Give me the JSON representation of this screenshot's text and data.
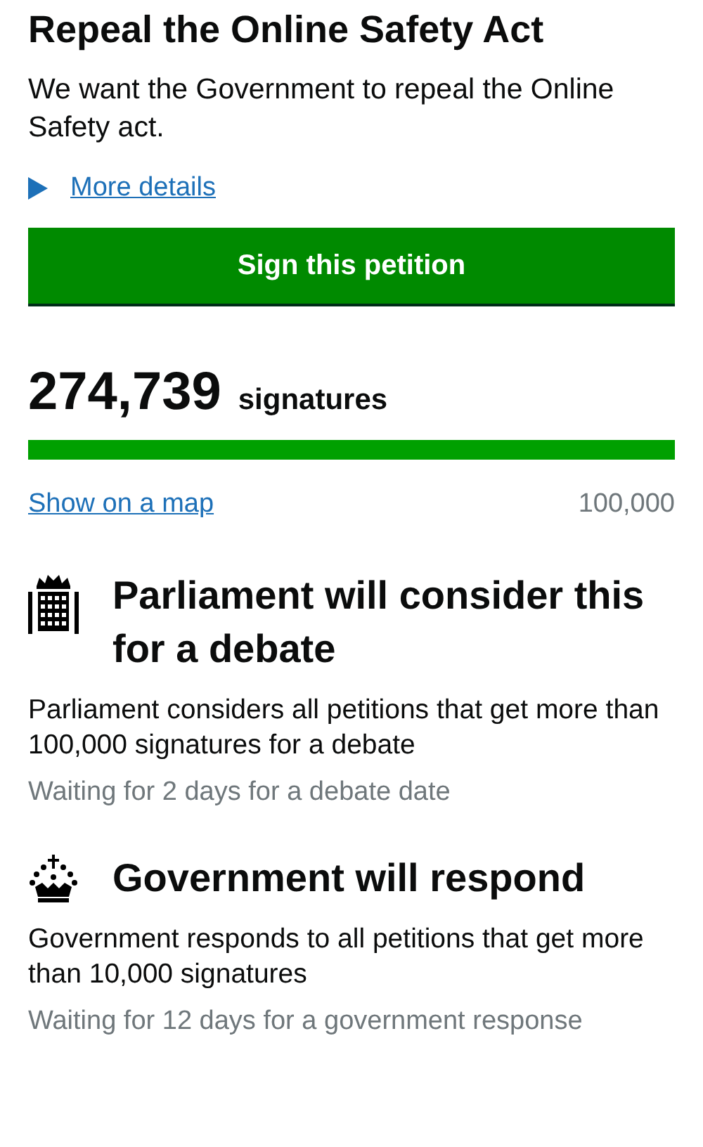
{
  "title": "Repeal the Online Safety Act",
  "summary": "We want the Government to repeal the Online Safety act.",
  "details": {
    "label": "More details",
    "expanded": false
  },
  "sign_button": "Sign this petition",
  "signatures": {
    "count": "274,739",
    "label": "signatures",
    "level": 1
  },
  "map_link": "Show on a map",
  "target": "100,000",
  "stages": [
    {
      "kind": "parliament",
      "heading": "Parliament will consider this for a debate",
      "text": "Parliament considers all petitions that get more than 100,000 signatures for a debate",
      "status": "Waiting for 2 days for a debate date"
    },
    {
      "kind": "government",
      "heading": "Government will respond",
      "text": "Government responds to all petitions that get more than 10,000 signatures",
      "status": "Waiting for 12 days for a government response"
    }
  ]
}
